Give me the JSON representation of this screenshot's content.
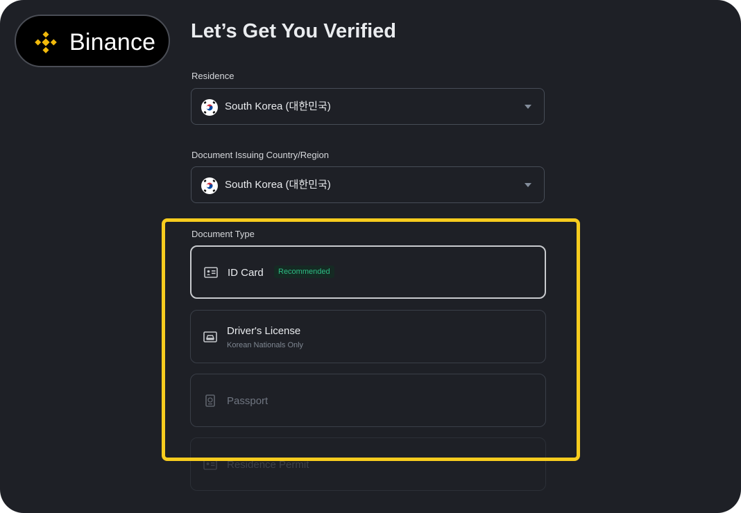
{
  "brand": {
    "name": "Binance",
    "color": "#f0b90b"
  },
  "title": "Let’s Get You Verified",
  "residence": {
    "label": "Residence",
    "value": "South Korea (대한민국)",
    "flag_icon": "south-korea-flag"
  },
  "issuing_country": {
    "label": "Document Issuing Country/Region",
    "value": "South Korea (대한민국)",
    "flag_icon": "south-korea-flag"
  },
  "document_type": {
    "label": "Document Type",
    "options": [
      {
        "label": "ID Card",
        "badge": "Recommended",
        "icon": "id-card-icon",
        "selected": true
      },
      {
        "label": "Driver's License",
        "sublabel": "Korean Nationals Only",
        "icon": "drivers-license-icon"
      },
      {
        "label": "Passport",
        "icon": "passport-icon"
      },
      {
        "label": "Residence Permit",
        "icon": "residence-permit-icon"
      }
    ]
  },
  "colors": {
    "background": "#1e2026",
    "highlight": "#f7cc1e",
    "badge_text": "#2ebd85"
  }
}
